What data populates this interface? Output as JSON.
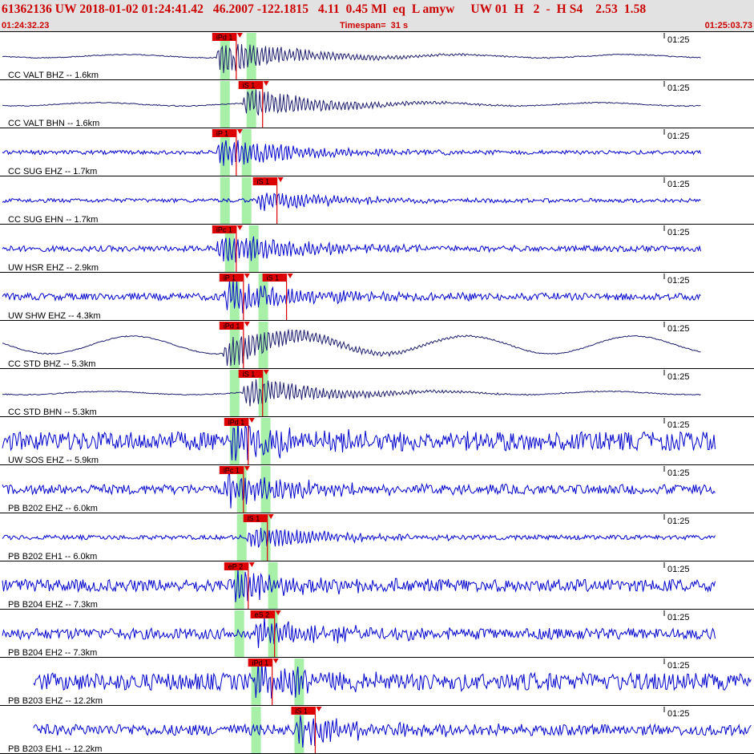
{
  "header": {
    "title": "61362136 UW 2018-01-02 01:24:41.42   46.2007 -122.1815   4.11  0.45 Ml  eq  L amyw     UW 01  H   2  -  H S4    2.53  1.58",
    "start_time": "01:24:32.23",
    "timespan": "Timespan=  31 s",
    "end_time": "01:25:03.73"
  },
  "colors": {
    "trace_blue": "#0000cc",
    "trace_dark": "#1c1c6e",
    "pick_red": "#dd0000",
    "window_green": "#a8f0a8",
    "header_bg": "#e2e2e2"
  },
  "channels": [
    {
      "label": "CC VALT BHZ -- 1.6km",
      "time_tick": "01:25",
      "picks": [
        {
          "label": "iPd 1",
          "t": 9.0
        }
      ],
      "windows": [
        9.4,
        10.5
      ],
      "amp": 1.0,
      "noise": 0.05,
      "color": "dark"
    },
    {
      "label": "CC VALT BHN -- 1.6km",
      "time_tick": "01:25",
      "picks": [
        {
          "label": "iS 1",
          "t": 10.1
        }
      ],
      "windows": [
        9.4,
        10.5
      ],
      "amp": 0.9,
      "noise": 0.05,
      "color": "dark"
    },
    {
      "label": "CC SUG EHZ -- 1.7km",
      "time_tick": "01:25",
      "picks": [
        {
          "label": "iP 1",
          "t": 9.0
        }
      ],
      "windows": [
        9.4,
        10.3
      ],
      "amp": 0.9,
      "noise": 0.03,
      "color": "blue"
    },
    {
      "label": "CC SUG EHN -- 1.7km",
      "time_tick": "01:25",
      "picks": [
        {
          "label": "iS 1",
          "t": 10.7
        }
      ],
      "windows": [
        9.4,
        10.3
      ],
      "amp": 0.6,
      "noise": 0.03,
      "color": "blue"
    },
    {
      "label": "UW HSR EHZ -- 2.9km",
      "time_tick": "01:25",
      "picks": [
        {
          "label": "iPc 1",
          "t": 9.0
        }
      ],
      "windows": [
        9.6,
        10.6
      ],
      "amp": 0.9,
      "noise": 0.1,
      "color": "blue"
    },
    {
      "label": "UW SHW EHZ -- 4.3km",
      "time_tick": "01:25",
      "picks": [
        {
          "label": "iP 1",
          "t": 9.3
        },
        {
          "label": "iS 1",
          "t": 11.1
        }
      ],
      "windows": [
        9.8,
        11.0
      ],
      "amp": 1.0,
      "noise": 0.15,
      "color": "blue"
    },
    {
      "label": "CC STD BHZ -- 5.3km",
      "time_tick": "01:25",
      "picks": [
        {
          "label": "iPd 1",
          "t": 9.3
        }
      ],
      "windows": [
        9.8,
        11.0
      ],
      "amp": 1.0,
      "noise": 0.1,
      "color": "dark"
    },
    {
      "label": "CC STD BHN -- 5.3km",
      "time_tick": "01:25",
      "picks": [
        {
          "label": "iS 1",
          "t": 10.1
        }
      ],
      "windows": [
        9.8,
        11.0
      ],
      "amp": 0.9,
      "noise": 0.05,
      "color": "dark"
    },
    {
      "label": "UW SOS EHZ -- 5.9km",
      "time_tick": "01:25",
      "picks": [
        {
          "label": "iPd 1",
          "t": 9.5
        }
      ],
      "windows": [
        9.8,
        11.1
      ],
      "amp": 1.0,
      "noise": 0.6,
      "color": "blue"
    },
    {
      "label": "PB B202 EHZ -- 6.0km",
      "time_tick": "01:25",
      "picks": [
        {
          "label": "iPc 1",
          "t": 9.3
        }
      ],
      "windows": [
        10.1,
        11.1
      ],
      "amp": 0.9,
      "noise": 0.25,
      "color": "blue"
    },
    {
      "label": "PB B202 EH1 -- 6.0km",
      "time_tick": "01:25",
      "picks": [
        {
          "label": "iS 1",
          "t": 10.3
        }
      ],
      "windows": [
        10.1,
        11.1
      ],
      "amp": 0.7,
      "noise": 0.05,
      "color": "blue"
    },
    {
      "label": "PB B204 EHZ -- 7.3km",
      "time_tick": "01:25",
      "picks": [
        {
          "label": "eP 2",
          "t": 9.5
        }
      ],
      "windows": [
        10.0,
        11.4
      ],
      "amp": 0.8,
      "noise": 0.35,
      "color": "blue"
    },
    {
      "label": "PB B204 EH2 -- 7.3km",
      "time_tick": "01:25",
      "picks": [
        {
          "label": "eS 2",
          "t": 10.6
        }
      ],
      "windows": [
        10.0,
        11.4
      ],
      "amp": 0.8,
      "noise": 0.3,
      "color": "blue"
    },
    {
      "label": "PB B203 EHZ -- 12.2km",
      "time_tick": "01:25",
      "picks": [
        {
          "label": "iPd 1",
          "t": 10.5
        }
      ],
      "windows": [
        10.7,
        12.5
      ],
      "amp": 0.9,
      "noise": 0.55,
      "color": "blue"
    },
    {
      "label": "PB B203 EH1 -- 12.2km",
      "time_tick": "01:25",
      "picks": [
        {
          "label": "iS 1",
          "t": 12.3
        }
      ],
      "windows": [
        10.7,
        12.5
      ],
      "amp": 0.8,
      "noise": 0.3,
      "color": "blue"
    }
  ]
}
